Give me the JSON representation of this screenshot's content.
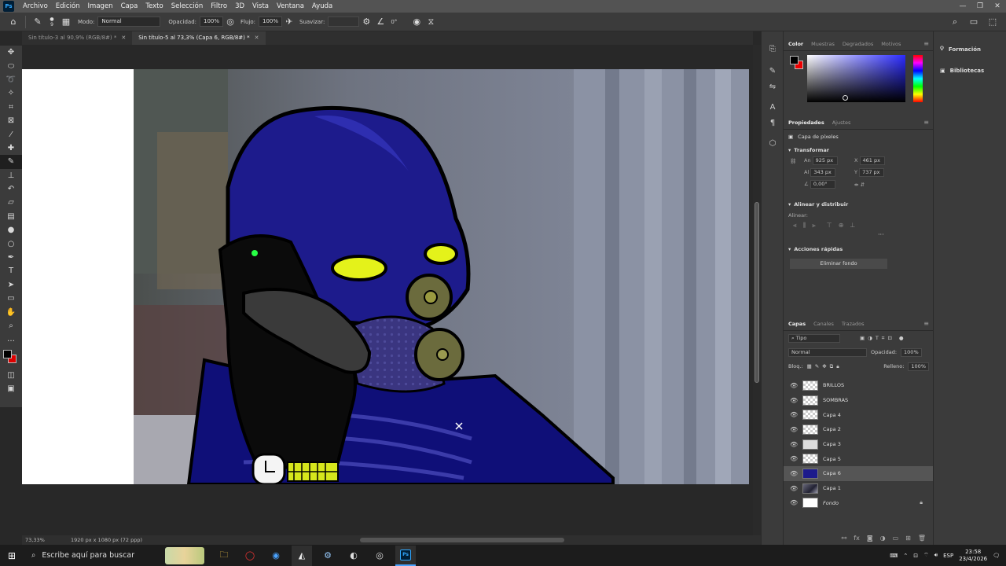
{
  "app": {
    "menu": [
      "Archivo",
      "Edición",
      "Imagen",
      "Capa",
      "Texto",
      "Selección",
      "Filtro",
      "3D",
      "Vista",
      "Ventana",
      "Ayuda"
    ],
    "logo": "Ps"
  },
  "options": {
    "mode_label": "Modo:",
    "mode_value": "Normal",
    "opacity_label": "Opacidad:",
    "opacity_value": "100%",
    "flow_label": "Flujo:",
    "flow_value": "100%",
    "smooth_label": "Suavizar:",
    "angle_value": "0°",
    "brush_size": "9"
  },
  "tabs": [
    {
      "label": "Sin título-3 al 90,9% (RGB/8#) *"
    },
    {
      "label": "Sin título-5 al 73,3% (Capa 6, RGB/8#) *"
    }
  ],
  "status": {
    "zoom": "73,33%",
    "doc_info": "1920 px x 1080 px (72 ppp)"
  },
  "color_panel": {
    "tabs": [
      "Color",
      "Muestras",
      "Degradados",
      "Motivos"
    ]
  },
  "properties": {
    "tabs": [
      "Propiedades",
      "Ajustes"
    ],
    "layer_kind": "Capa de píxeles",
    "transform_title": "Transformar",
    "an_label": "An",
    "an_value": "925 px",
    "al_label": "Al",
    "al_value": "343 px",
    "x_label": "X",
    "x_value": "461 px",
    "y_label": "Y",
    "y_value": "737 px",
    "angle_value": "0,00°",
    "align_title": "Alinear y distribuir",
    "align_label": "Alinear:",
    "quick_title": "Acciones rápidas",
    "remove_bg": "Eliminar fondo"
  },
  "layers_panel": {
    "tabs": [
      "Capas",
      "Canales",
      "Trazados"
    ],
    "filter_value": "Tipo",
    "blend_mode": "Normal",
    "opacity_label": "Opacidad:",
    "opacity_value": "100%",
    "lock_label": "Bloq.:",
    "fill_label": "Relleno:",
    "fill_value": "100%",
    "layers": [
      {
        "name": "BRILLOS"
      },
      {
        "name": "SOMBRAS"
      },
      {
        "name": "Capa 4"
      },
      {
        "name": "Capa 2"
      },
      {
        "name": "Capa 3"
      },
      {
        "name": "Capa 5"
      },
      {
        "name": "Capa 6"
      },
      {
        "name": "Capa 1"
      },
      {
        "name": "Fondo"
      }
    ]
  },
  "learn": {
    "items": [
      "Formación",
      "Bibliotecas"
    ]
  },
  "taskbar": {
    "search_placeholder": "Escribe aquí para buscar",
    "lang": "ESP",
    "time": "23:58",
    "date": "23/4/2026"
  }
}
